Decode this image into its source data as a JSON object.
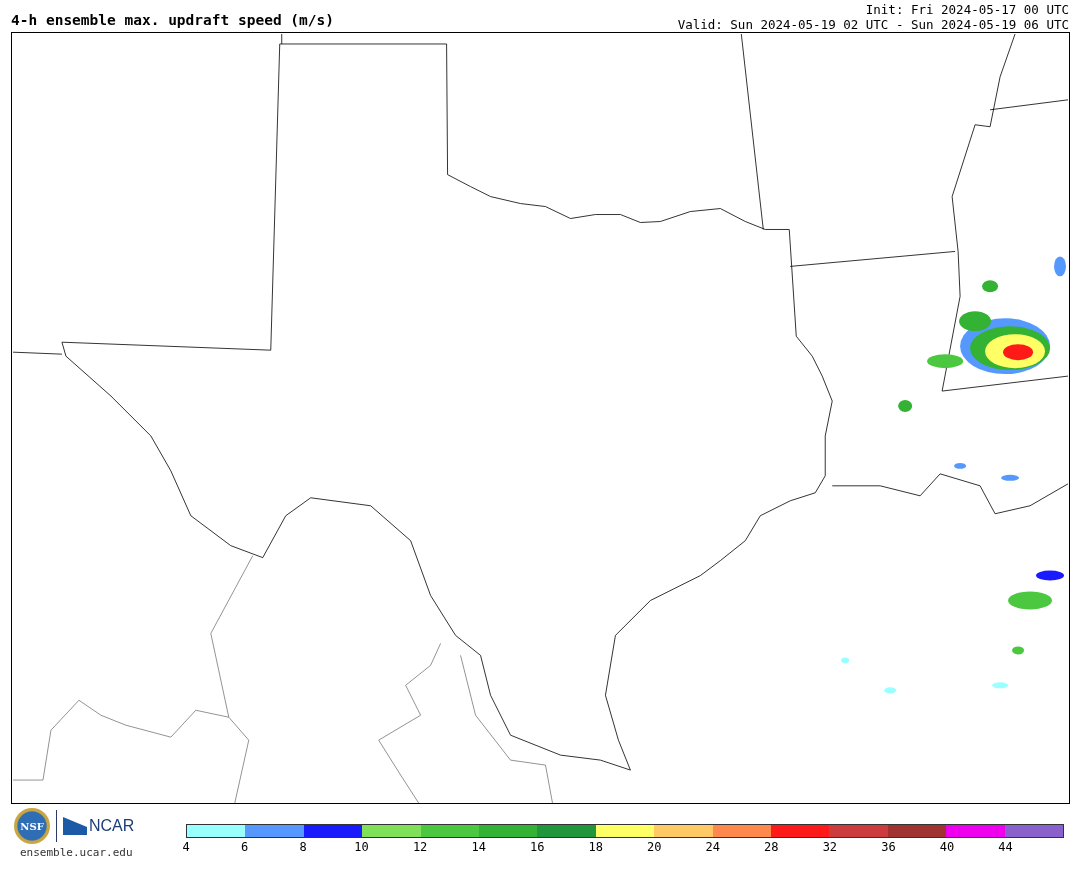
{
  "header": {
    "title": "4-h ensemble max. updraft speed (m/s)",
    "init": "Init: Fri 2024-05-17 00 UTC",
    "valid": "Valid: Sun 2024-05-19 02 UTC - Sun 2024-05-19 06 UTC"
  },
  "footer": {
    "nsf_logo": "NSF",
    "ncar_logo": "NCAR",
    "url": "ensemble.ucar.edu"
  },
  "colorbar": [
    {
      "label": "4",
      "color": "#99ffff"
    },
    {
      "label": "6",
      "color": "#5599ff"
    },
    {
      "label": "8",
      "color": "#1a1aff"
    },
    {
      "label": "10",
      "color": "#80e05a"
    },
    {
      "label": "12",
      "color": "#4cc840"
    },
    {
      "label": "14",
      "color": "#33b233"
    },
    {
      "label": "16",
      "color": "#22963c"
    },
    {
      "label": "18",
      "color": "#ffff66"
    },
    {
      "label": "20",
      "color": "#ffc966"
    },
    {
      "label": "24",
      "color": "#ff884c"
    },
    {
      "label": "28",
      "color": "#ff1a1a"
    },
    {
      "label": "32",
      "color": "#cc3c3c"
    },
    {
      "label": "36",
      "color": "#a03232"
    },
    {
      "label": "40",
      "color": "#ee00ee"
    },
    {
      "label": "44",
      "color": "#8a60cc"
    }
  ]
}
